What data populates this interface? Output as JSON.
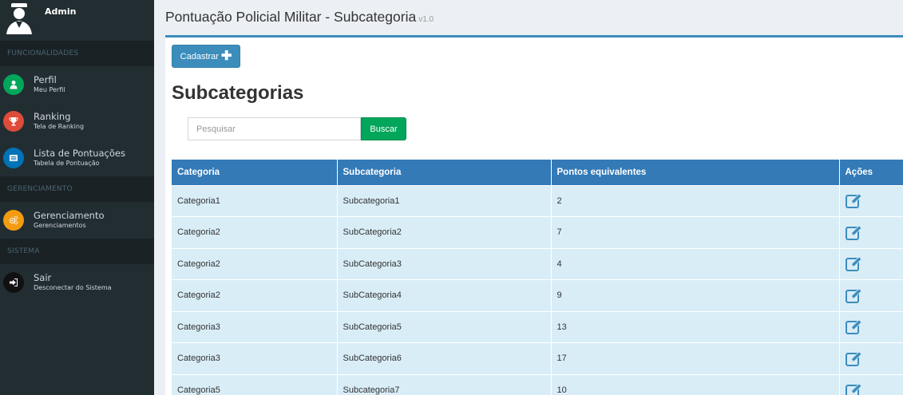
{
  "user": {
    "name": "Admin"
  },
  "sidebar": {
    "sections": [
      {
        "header": "FUNCIONALIDADES",
        "items": [
          {
            "title": "Perfil",
            "subtitle": "Meu Perfil",
            "icon": "user-icon",
            "color": "#00a65a"
          },
          {
            "title": "Ranking",
            "subtitle": "Tela de Ranking",
            "icon": "trophy-icon",
            "color": "#dd4b39"
          },
          {
            "title": "Lista de Pontuações",
            "subtitle": "Tabela de Pontuação",
            "icon": "list-icon",
            "color": "#0073b7"
          }
        ]
      },
      {
        "header": "GERENCIAMENTO",
        "items": [
          {
            "title": "Gerenciamento",
            "subtitle": "Gerenciamentos",
            "icon": "cogs-icon",
            "color": "#f39c12"
          }
        ]
      },
      {
        "header": "SISTEMA",
        "items": [
          {
            "title": "Sair",
            "subtitle": "Desconectar do Sistema",
            "icon": "sign-out-icon",
            "color": "#111111"
          }
        ]
      }
    ]
  },
  "header": {
    "title": "Pontuação Policial Militar - Subcategoria",
    "version": "v1.0"
  },
  "main": {
    "cadastrar_label": "Cadastrar",
    "section_title": "Subcategorias",
    "search": {
      "placeholder": "Pesquisar",
      "value": "",
      "button_label": "Buscar"
    },
    "table": {
      "columns": [
        "Categoria",
        "Subcategoria",
        "Pontos equivalentes",
        "Ações"
      ],
      "rows": [
        [
          "Categoria1",
          "Subcategoria1",
          "2"
        ],
        [
          "Categoria2",
          "SubCategoria2",
          "7"
        ],
        [
          "Categoria2",
          "SubCategoria3",
          "4"
        ],
        [
          "Categoria2",
          "SubCategoria4",
          "9"
        ],
        [
          "Categoria3",
          "SubCategoria5",
          "13"
        ],
        [
          "Categoria3",
          "SubCategoria6",
          "17"
        ],
        [
          "Categoria5",
          "Subcategoria7",
          "10"
        ]
      ]
    }
  },
  "colors": {
    "primary": "#3c8dbc",
    "table_header": "#337ab7",
    "row_bg": "#d9edf7",
    "success": "#00a65a",
    "sidebar_bg": "#222d32"
  }
}
